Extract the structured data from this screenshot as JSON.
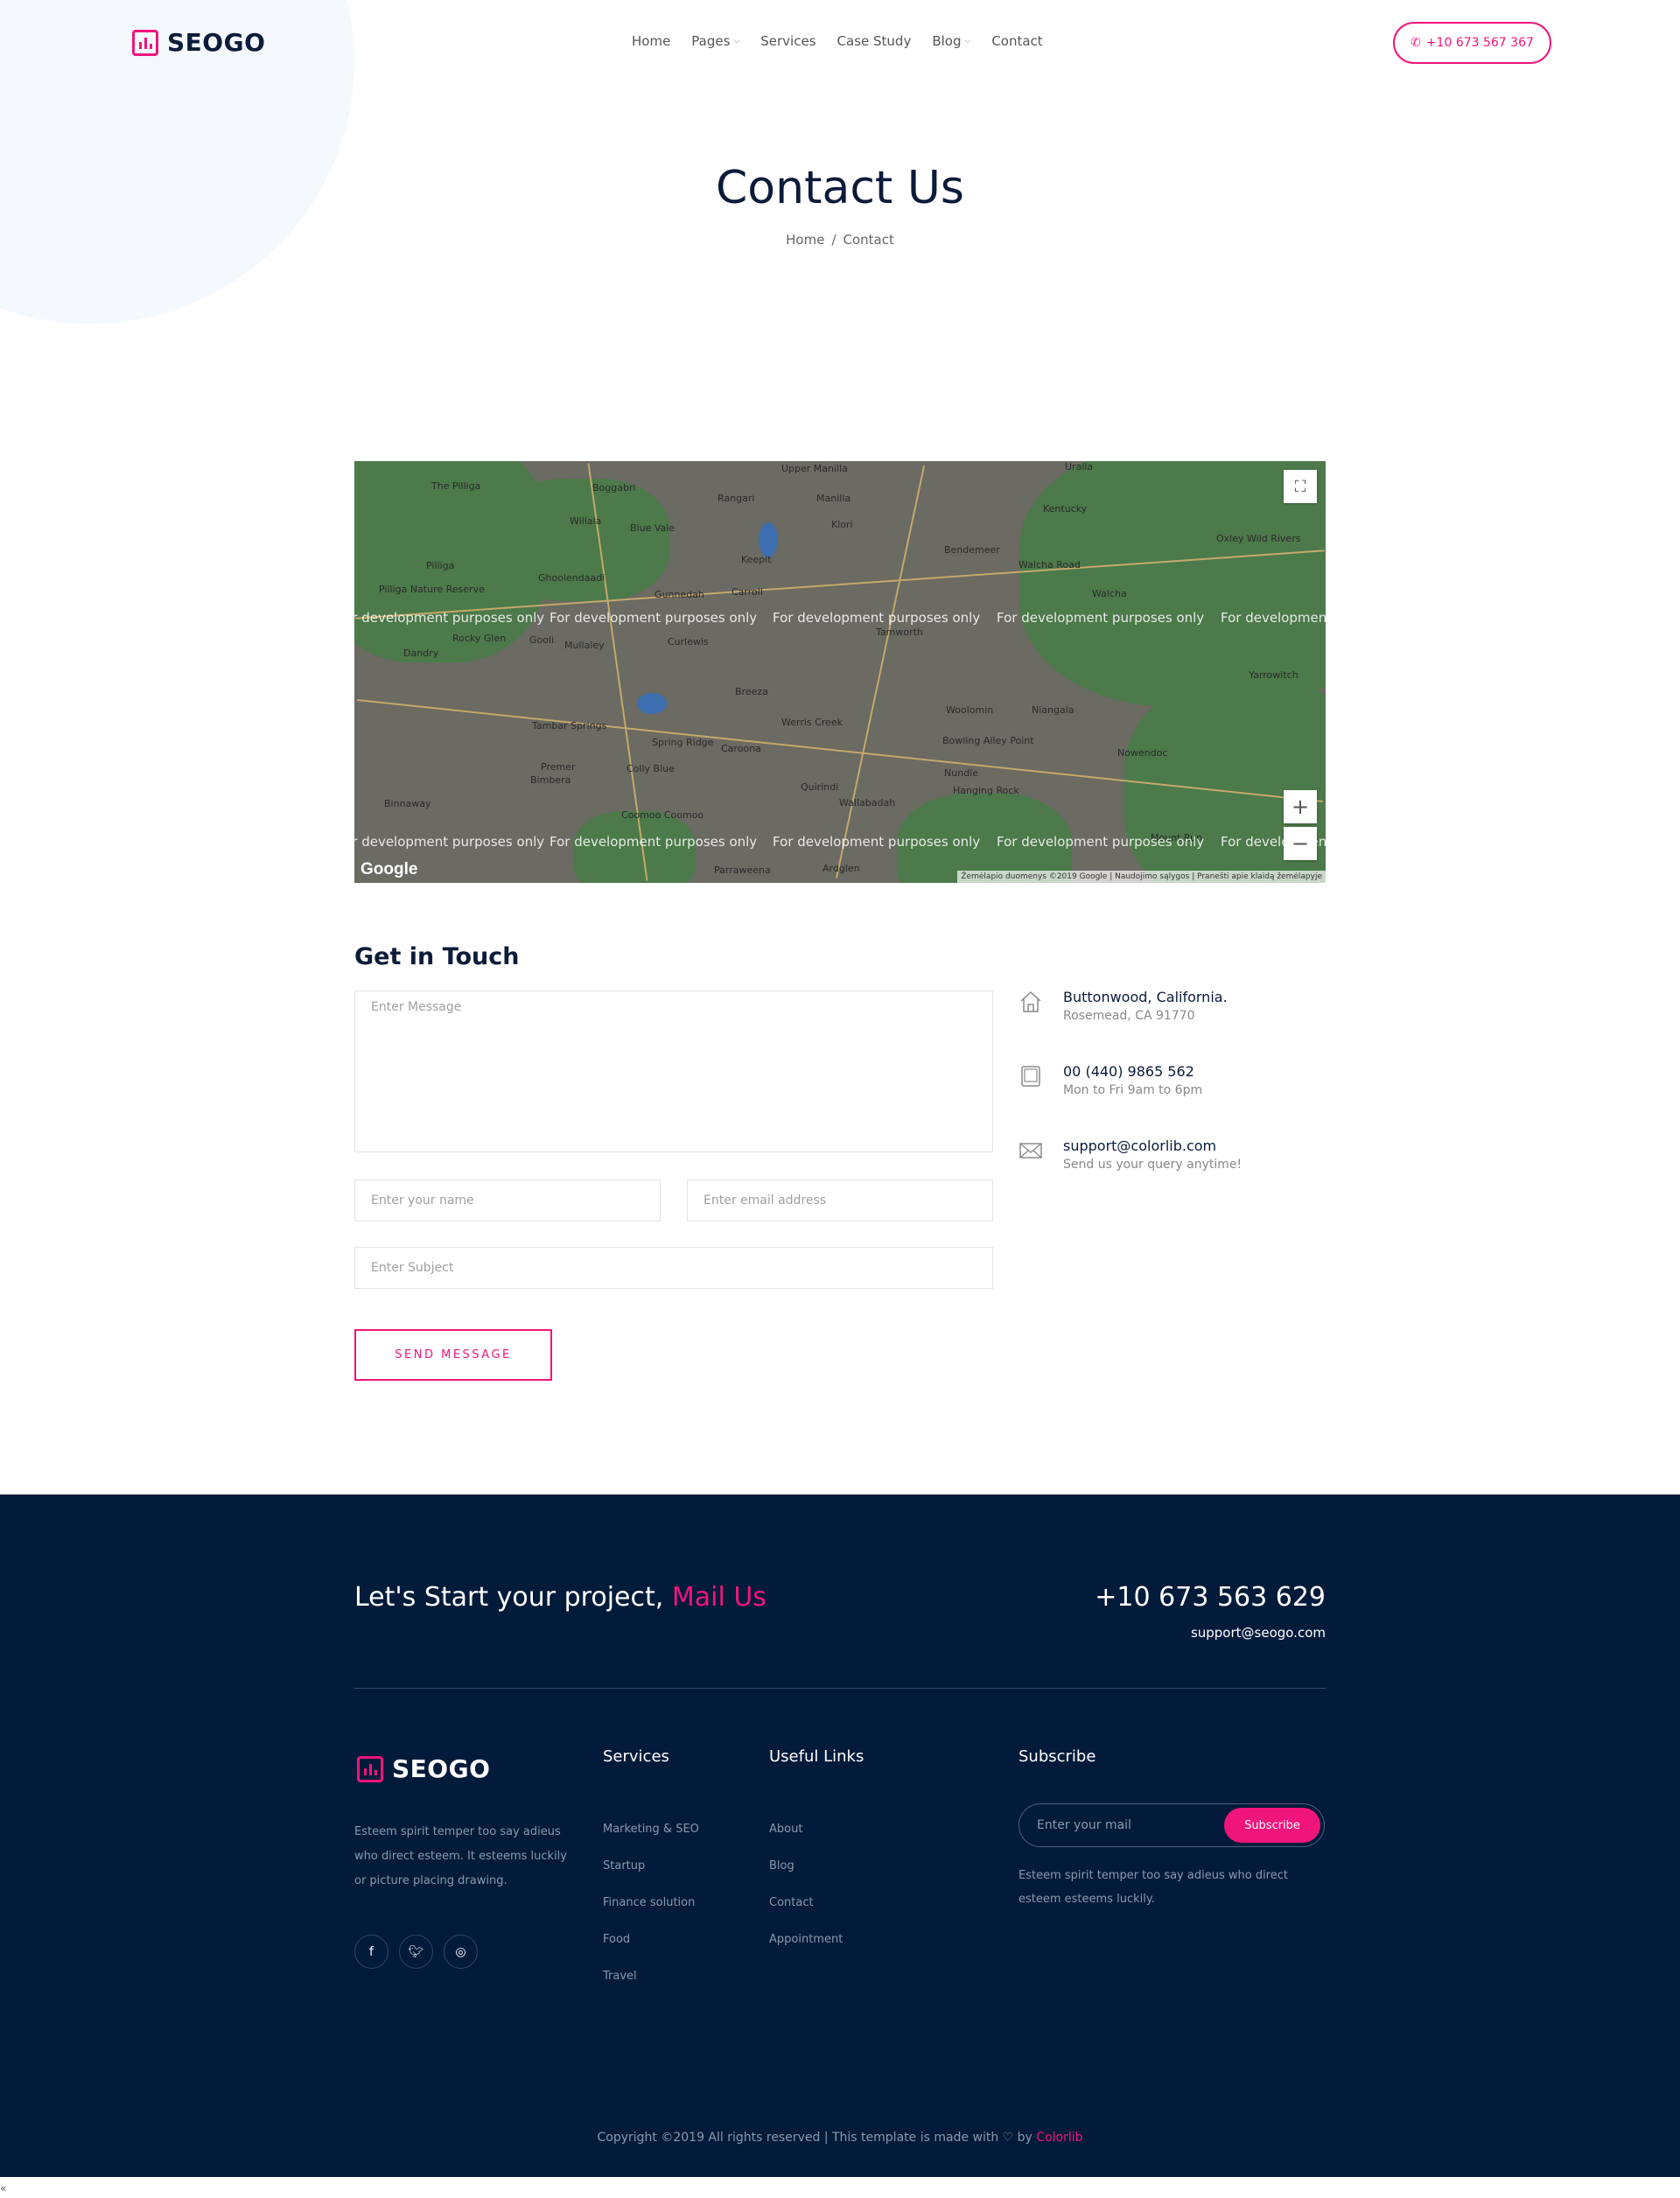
{
  "brand": {
    "name": "SEOGO",
    "accent": "#f0157b",
    "navy": "#031b3a"
  },
  "nav": {
    "items": [
      {
        "label": "Home",
        "dropdown": false
      },
      {
        "label": "Pages",
        "dropdown": true
      },
      {
        "label": "Services",
        "dropdown": false
      },
      {
        "label": "Case Study",
        "dropdown": false
      },
      {
        "label": "Blog",
        "dropdown": true
      },
      {
        "label": "Contact",
        "dropdown": false
      }
    ],
    "phone": "+10 673 567 367"
  },
  "hero": {
    "title": "Contact Us",
    "crumb_home": "Home",
    "crumb_sep": "/",
    "crumb_current": "Contact"
  },
  "map": {
    "watermark": "For development purposes only",
    "google": "Google",
    "attribution": "Žemėlapio duomenys ©2019 Google | Naudojimo sąlygos | Pranešti apie klaidą žemėlapyje",
    "places": [
      "The Pilliga",
      "Boggabri",
      "Rangari",
      "Upper Manilla",
      "Uralla",
      "Manilla",
      "Willala",
      "Blue Vale",
      "Klori",
      "Kentucky",
      "Bendemeer",
      "Pilliga",
      "Keepit",
      "Walcha Road",
      "Oxley Wild Rivers",
      "Pilliga Nature Reserve",
      "Gunnedah",
      "Carroll",
      "Ghoolendaadi",
      "Walcha",
      "Curlewis",
      "Gooli",
      "Mullaley",
      "Rocky Glen",
      "Tamworth",
      "Dandry",
      "Breeza",
      "Yarrowitch",
      "Woolomin",
      "Niangala",
      "Werris Creek",
      "Tambar Springs",
      "Spring Ridge",
      "Caroona",
      "Bowling Alley Point",
      "Nowendoc",
      "Premer",
      "Colly Blue",
      "Nundle",
      "Hanging Rock",
      "Quirindi",
      "Bimbera",
      "Binnaway",
      "Wallabadah",
      "Coomoo Coomoo",
      "Parraweena",
      "Ardglen",
      "Mount Run"
    ]
  },
  "contact": {
    "heading": "Get in Touch",
    "message_placeholder": "Enter Message",
    "name_placeholder": "Enter your name",
    "email_placeholder": "Enter email address",
    "subject_placeholder": "Enter Subject",
    "submit": "SEND MESSAGE",
    "info": [
      {
        "icon": "home-icon",
        "title": "Buttonwood, California.",
        "sub": "Rosemead, CA 91770"
      },
      {
        "icon": "tablet-icon",
        "title": "00 (440) 9865 562",
        "sub": "Mon to Fri 9am to 6pm"
      },
      {
        "icon": "mail-icon",
        "title": "support@colorlib.com",
        "sub": "Send us your query anytime!"
      }
    ]
  },
  "footer": {
    "cta_text": "Let's Start your project,",
    "cta_link": "Mail Us",
    "phone": "+10 673 563 629",
    "email": "support@seogo.com",
    "about": "Esteem spirit temper too say adieus who direct esteem. It esteems luckily or picture placing drawing.",
    "social": [
      "facebook-icon",
      "twitter-icon",
      "instagram-icon"
    ],
    "services_title": "Services",
    "services": [
      "Marketing & SEO",
      "Startup",
      "Finance solution",
      "Food",
      "Travel"
    ],
    "links_title": "Useful Links",
    "links": [
      "About",
      "Blog",
      "Contact",
      "Appointment"
    ],
    "subscribe_title": "Subscribe",
    "subscribe_placeholder": "Enter your mail",
    "subscribe_button": "Subscribe",
    "subscribe_desc": "Esteem spirit temper too say adieus who direct esteem esteems luckily.",
    "copyright_pre": "Copyright ©2019 All rights reserved | This template is made with",
    "copyright_by": "by",
    "copyright_link": "Colorlib"
  }
}
